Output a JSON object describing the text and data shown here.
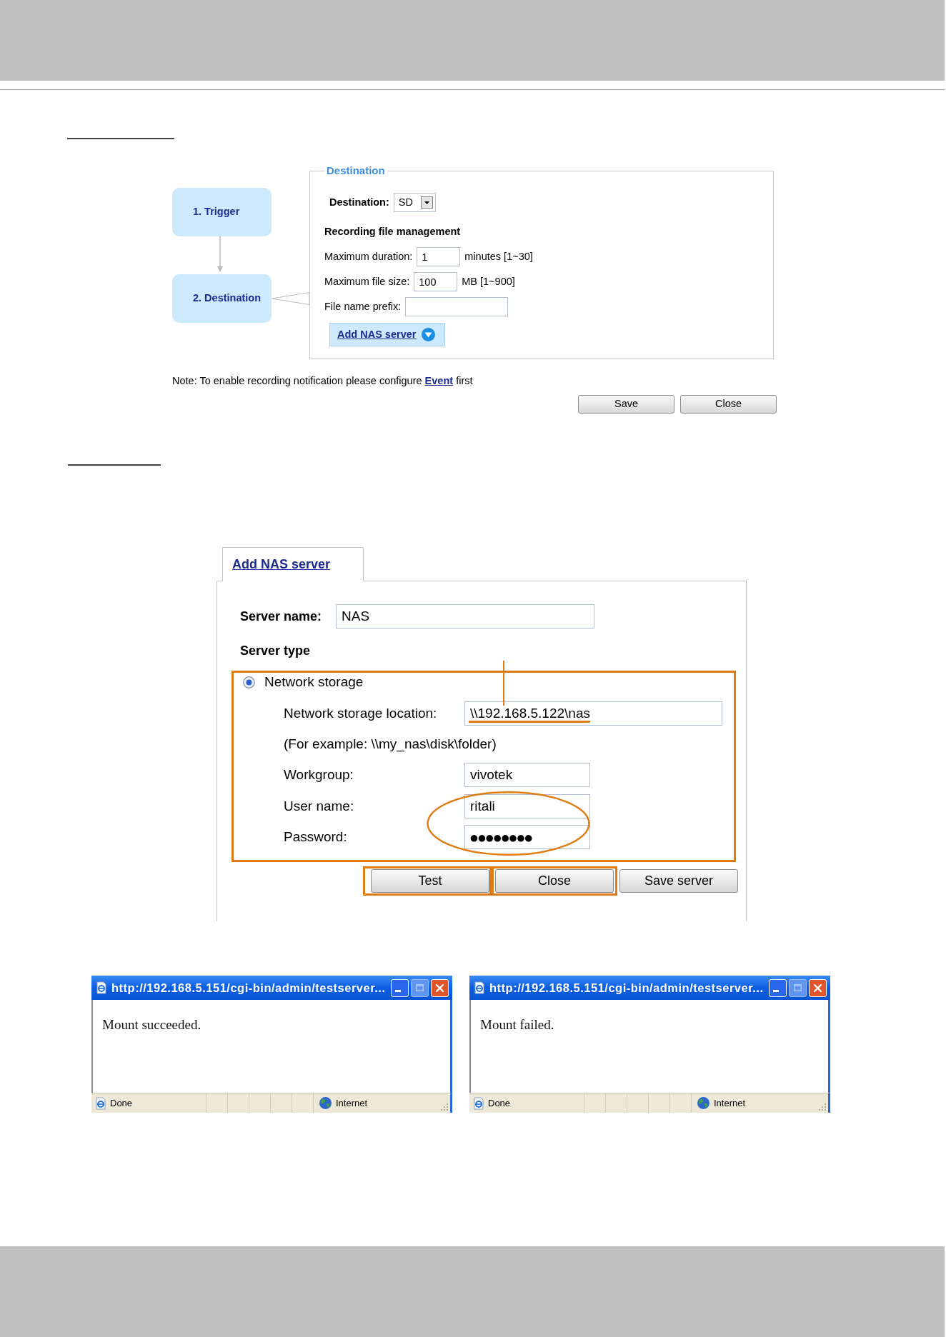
{
  "recording_dialog": {
    "steps": [
      {
        "label": "1. Trigger"
      },
      {
        "label": "2. Destination"
      }
    ],
    "legend": "Destination",
    "destination": {
      "label": "Destination:",
      "value": "SD"
    },
    "section_title": "Recording file management",
    "fields": [
      {
        "kind": "number",
        "label": "Maximum duration:",
        "value": "1",
        "unit": "minutes [1~30]"
      },
      {
        "kind": "number",
        "label": "Maximum file size:",
        "value": "100",
        "unit": "MB [1~900]"
      },
      {
        "kind": "text",
        "label": "File name prefix:"
      }
    ],
    "add_nas_link": "Add NAS server",
    "note": {
      "before": "Note: To enable recording notification please configure ",
      "link": "Event",
      "after": " first"
    },
    "buttons": [
      "Save",
      "Close"
    ]
  },
  "nas_dialog": {
    "tab": "Add NAS server",
    "server_name": {
      "label": "Server name:",
      "value": "NAS"
    },
    "server_type_title": "Server type",
    "server_types": [
      {
        "label": "Network storage",
        "selected": true
      }
    ],
    "fields": [
      {
        "kind": "wide_input",
        "label": "Network storage location:",
        "value": "\\\\192.168.5.122\\nas"
      },
      {
        "kind": "hint",
        "label": "(For example: \\\\my_nas\\disk\\folder)"
      },
      {
        "kind": "input",
        "label": "Workgroup:",
        "value": "vivotek"
      },
      {
        "kind": "input",
        "label": "User name:",
        "value": "ritali"
      },
      {
        "kind": "password",
        "label": "Password:",
        "value": "●●●●●●●●"
      }
    ],
    "buttons": [
      {
        "label": "Test",
        "highlighted": true
      },
      {
        "label": "Close",
        "highlighted": true
      },
      {
        "label": "Save server",
        "highlighted": false
      }
    ]
  },
  "popups": [
    {
      "title": "http://192.168.5.151/cgi-bin/admin/testserver...",
      "title_buttons": [
        {
          "kind": "minimize",
          "disabled": false
        },
        {
          "kind": "maximize",
          "disabled": true
        },
        {
          "kind": "close",
          "disabled": false
        }
      ],
      "message": "Mount succeeded.",
      "status": "Done",
      "zone": "Internet"
    },
    {
      "title": "http://192.168.5.151/cgi-bin/admin/testserver...",
      "title_buttons": [
        {
          "kind": "minimize",
          "disabled": false
        },
        {
          "kind": "maximize",
          "disabled": true
        },
        {
          "kind": "close",
          "disabled": false
        }
      ],
      "message": "Mount failed.",
      "status": "Done",
      "zone": "Internet"
    }
  ]
}
